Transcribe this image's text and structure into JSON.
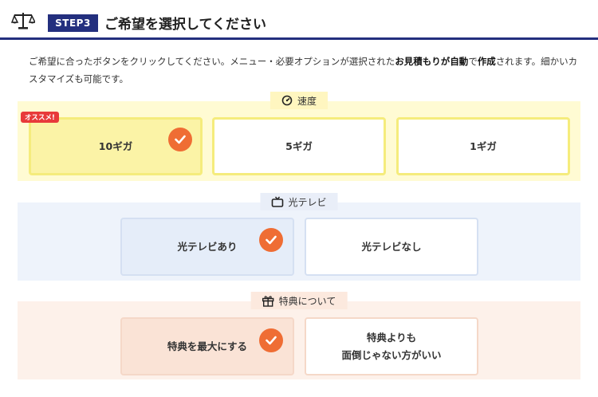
{
  "header": {
    "step_badge": "STEP3",
    "title": "ご希望を選択してください",
    "icon": "scale-icon",
    "accent_color": "#232f7e"
  },
  "intro": {
    "text_before": "ご希望に合ったボタンをクリックしてください。メニュー・必要オプションが選択された",
    "bold_1": "お見積もりが",
    "bold_2": "自動",
    "text_middle": "で",
    "bold_3": "作成",
    "text_after": "されます。細かいカスタマイズも可能です。"
  },
  "speed": {
    "label": "速度",
    "icon": "speedometer-icon",
    "badge": "オススメ!",
    "options": [
      {
        "label": "10ギガ",
        "selected": true
      },
      {
        "label": "5ギガ",
        "selected": false
      },
      {
        "label": "1ギガ",
        "selected": false
      }
    ]
  },
  "tv": {
    "label": "光テレビ",
    "icon": "tv-icon",
    "options": [
      {
        "label": "光テレビあり",
        "selected": true
      },
      {
        "label": "光テレビなし",
        "selected": false
      }
    ]
  },
  "bonus": {
    "label": "特典について",
    "icon": "gift-icon",
    "options": [
      {
        "label": "特典を最大にする",
        "selected": true
      },
      {
        "label_line1": "特典よりも",
        "label_line2": "面倒じゃない方がいい",
        "selected": false
      }
    ]
  },
  "colors": {
    "check": "#ef6d34",
    "badge": "#e83a3a",
    "speed_bg": "#fffbd3",
    "tv_bg": "#eef3fb",
    "bonus_bg": "#fdf1ea"
  }
}
